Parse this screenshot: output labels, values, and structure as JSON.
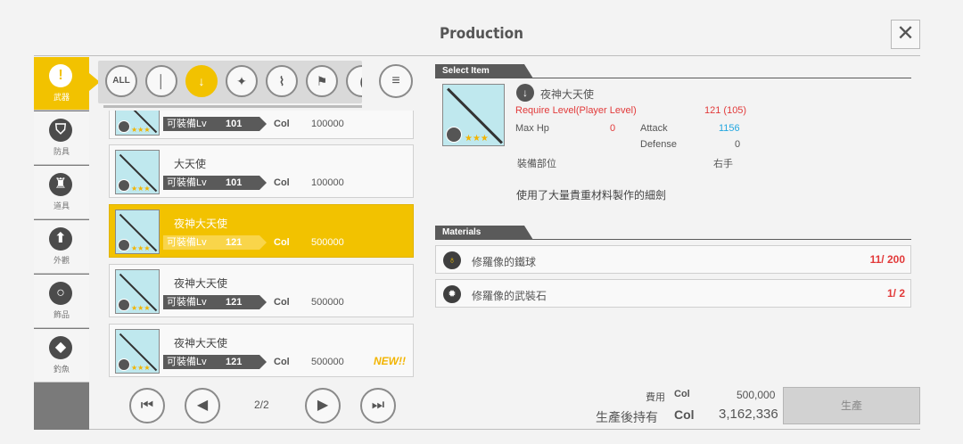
{
  "title": "Production",
  "categories": [
    {
      "label": "武器",
      "icon": "sword-icon",
      "glyph": "!",
      "active": true
    },
    {
      "label": "防具",
      "icon": "armor-icon",
      "glyph": "⛉",
      "active": false
    },
    {
      "label": "道具",
      "icon": "potion-icon",
      "glyph": "♜",
      "active": false
    },
    {
      "label": "外觀",
      "icon": "shirt-icon",
      "glyph": "⬆",
      "active": false
    },
    {
      "label": "飾品",
      "icon": "ring-icon",
      "glyph": "○",
      "active": false
    },
    {
      "label": "釣魚",
      "icon": "fishing-icon",
      "glyph": "◆",
      "active": false
    }
  ],
  "filters": [
    {
      "label": "ALL",
      "icon": "all-filter-icon"
    },
    {
      "label": "│",
      "icon": "one-handed-sword-icon"
    },
    {
      "label": "↓",
      "icon": "rapier-icon",
      "active": true
    },
    {
      "label": "✦",
      "icon": "dagger-icon"
    },
    {
      "label": "⌇",
      "icon": "curved-sword-icon"
    },
    {
      "label": "⚑",
      "icon": "axe-icon"
    },
    {
      "label": "(",
      "icon": "more-weapon-icon"
    }
  ],
  "list": {
    "rows": [
      {
        "name": "",
        "equip_label": "可裝備Lv",
        "lv": "101",
        "col_label": "Col",
        "col": "100000",
        "new": "",
        "active": false
      },
      {
        "name": "大天使",
        "equip_label": "可裝備Lv",
        "lv": "101",
        "col_label": "Col",
        "col": "100000",
        "new": "",
        "active": false
      },
      {
        "name": "夜神大天使",
        "equip_label": "可裝備Lv",
        "lv": "121",
        "col_label": "Col",
        "col": "500000",
        "new": "",
        "active": true
      },
      {
        "name": "夜神大天使",
        "equip_label": "可裝備Lv",
        "lv": "121",
        "col_label": "Col",
        "col": "500000",
        "new": "",
        "active": false
      },
      {
        "name": "夜神大天使",
        "equip_label": "可裝備Lv",
        "lv": "121",
        "col_label": "Col",
        "col": "500000",
        "new": "NEW!!",
        "active": false
      }
    ],
    "page": "2/2"
  },
  "detail": {
    "header": "Select Item",
    "name": "夜神大天使",
    "require_label": "Require Level(Player Level)",
    "require_value": "121 (105)",
    "maxhp_label": "Max Hp",
    "maxhp_value": "0",
    "attack_label": "Attack",
    "attack_value": "1156",
    "defense_label": "Defense",
    "defense_value": "0",
    "slot_label": "裝備部位",
    "slot_value": "右手",
    "description": "使用了大量貴重材料製作的細劍"
  },
  "materials": {
    "header": "Materials",
    "items": [
      {
        "name": "修羅像的鐵球",
        "count": "11/ 200",
        "icon": "iron-ball-icon",
        "glyph": "♁"
      },
      {
        "name": "修羅像的武裝石",
        "count": "1/  2",
        "icon": "armament-stone-icon",
        "glyph": "✹"
      }
    ]
  },
  "cost": {
    "fee_label": "費用",
    "fee_unit": "Col",
    "fee_value": "500,000",
    "own_label": "生產後持有",
    "own_unit": "Col",
    "own_value": "3,162,336",
    "produce_button": "生產"
  }
}
